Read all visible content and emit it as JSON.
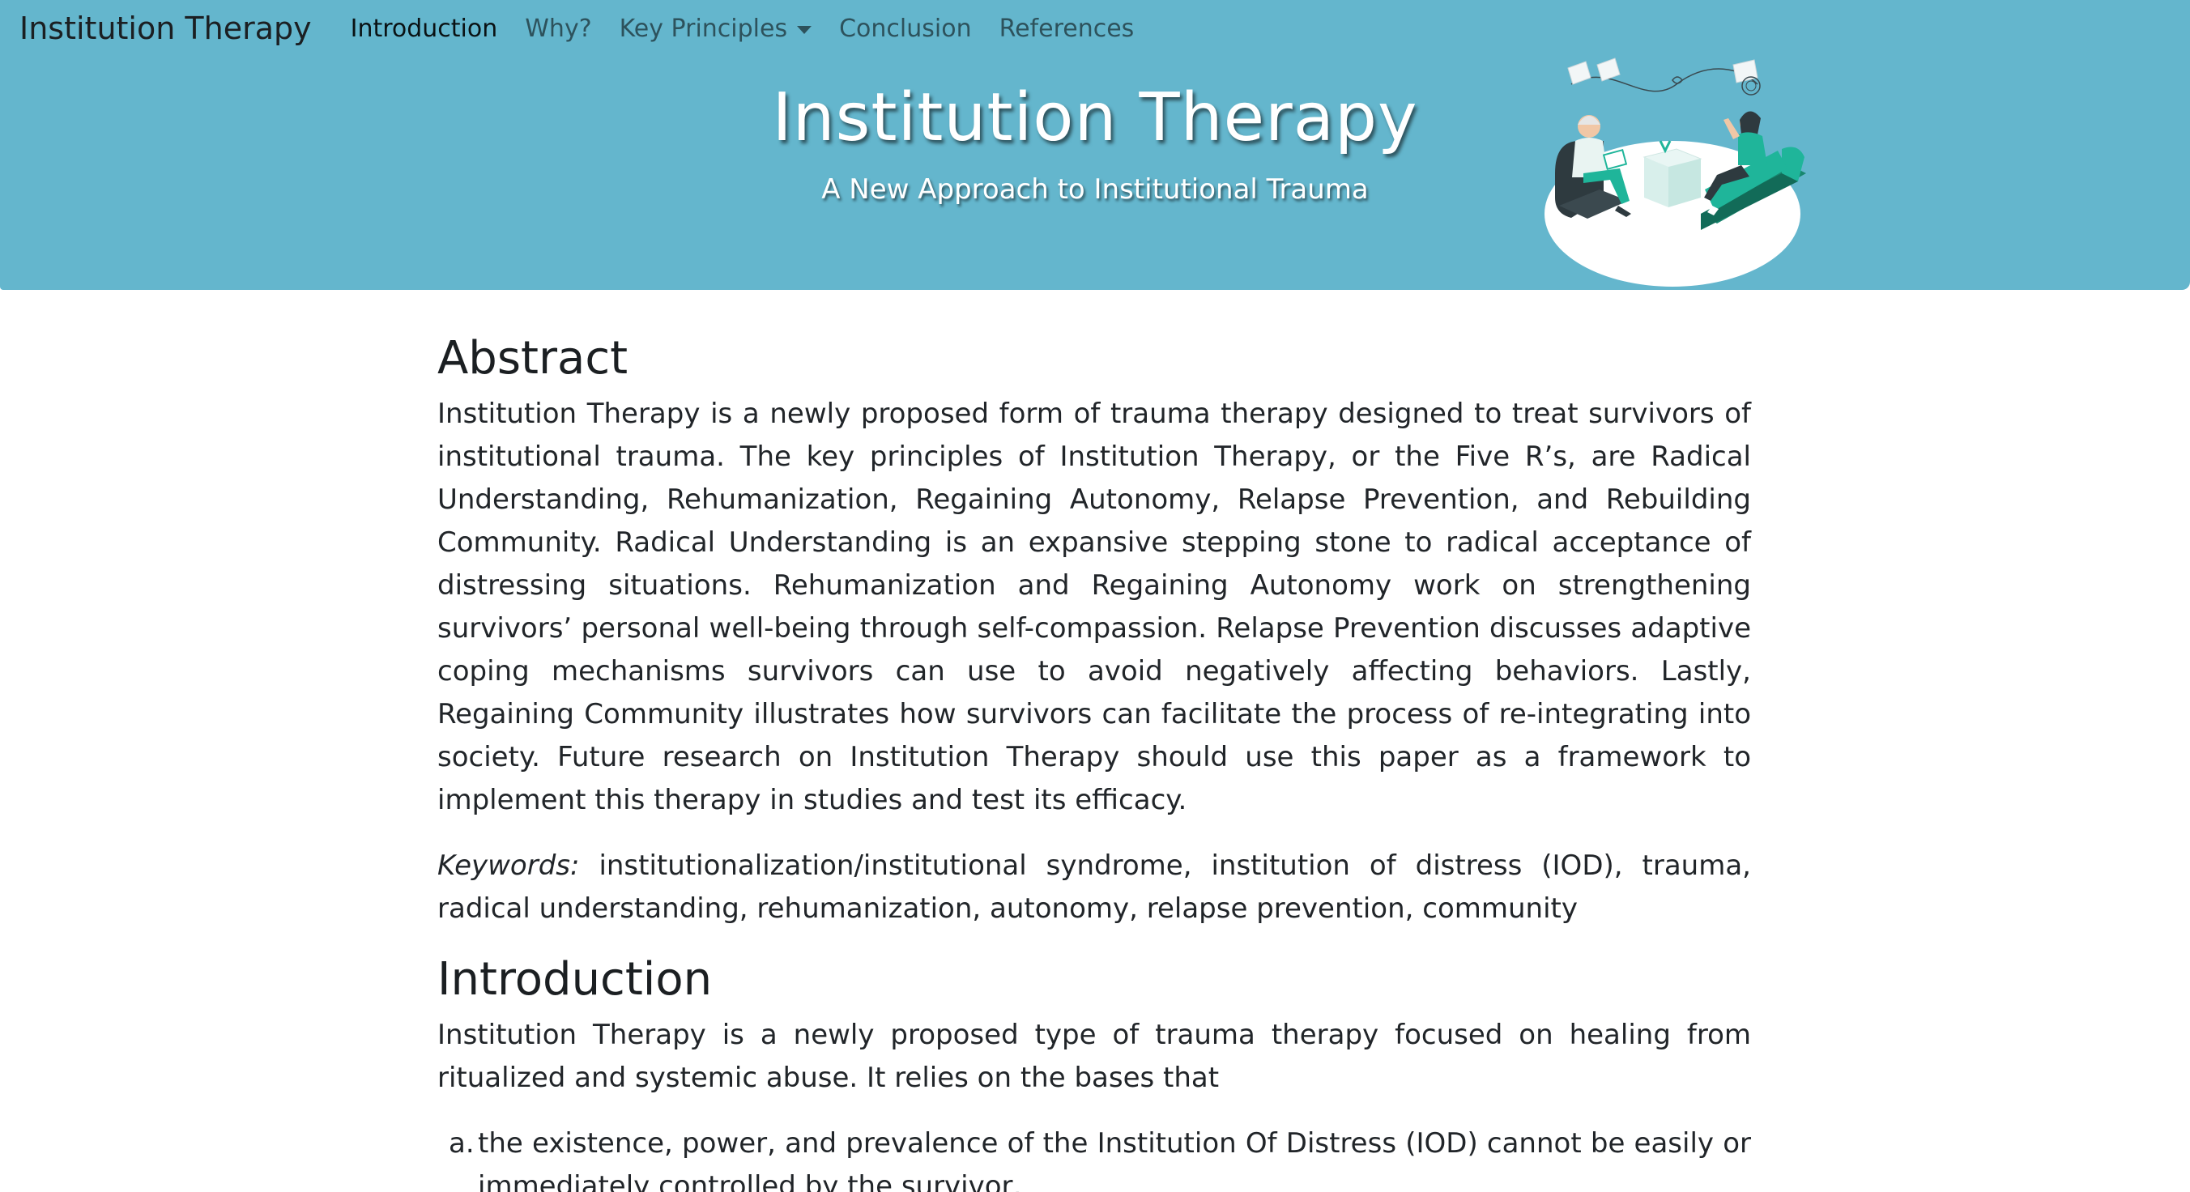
{
  "navbar": {
    "brand": "Institution Therapy",
    "items": [
      {
        "label": "Introduction",
        "active": true
      },
      {
        "label": "Why?",
        "active": false
      },
      {
        "label": "Key Principles",
        "active": false,
        "dropdown": true
      },
      {
        "label": "Conclusion",
        "active": false
      },
      {
        "label": "References",
        "active": false
      }
    ]
  },
  "hero": {
    "title": "Institution Therapy",
    "subtitle": "A New Approach to Institutional Trauma",
    "illustration_icon": "therapy-session-illustration-icon"
  },
  "colors": {
    "banner": "#64b6cd",
    "text": "#212529",
    "hero_text": "#ffffff",
    "illustration_teal": "#1fb59a",
    "illustration_dark": "#2e3a3f"
  },
  "abstract": {
    "heading": "Abstract",
    "body": "Institution Therapy is a newly proposed form of trauma therapy designed to treat survivors of institutional trauma. The key principles of Institution Therapy, or the Five R’s, are Radical Understanding, Rehumanization, Regaining Autonomy, Relapse Prevention, and Rebuilding Community. Radical Understanding is an expansive stepping stone to radical acceptance of distressing situations. Rehumanization and Regaining Autonomy work on strengthening survivors’ personal well-being through self-compassion. Relapse Prevention discusses adaptive coping mechanisms survivors can use to avoid negatively affecting behaviors. Lastly, Regaining Community illustrates how survivors can facilitate the process of re-integrating into society. Future research on Institution Therapy should use this paper as a framework to implement this therapy in studies and test its efficacy.",
    "keywords_label": "Keywords:",
    "keywords": "institutionalization/institutional syndrome, institution of distress (IOD), trauma, radical understanding, rehumanization, autonomy, relapse prevention, community"
  },
  "introduction": {
    "heading": "Introduction",
    "body": "Institution Therapy is a newly proposed type of trauma therapy focused on healing from ritualized and systemic abuse. It relies on the bases that",
    "list": [
      {
        "marker": "a.",
        "text": "the existence, power, and prevalence of the Institution Of Distress (IOD) cannot be easily or immediately controlled by the survivor,"
      }
    ]
  }
}
